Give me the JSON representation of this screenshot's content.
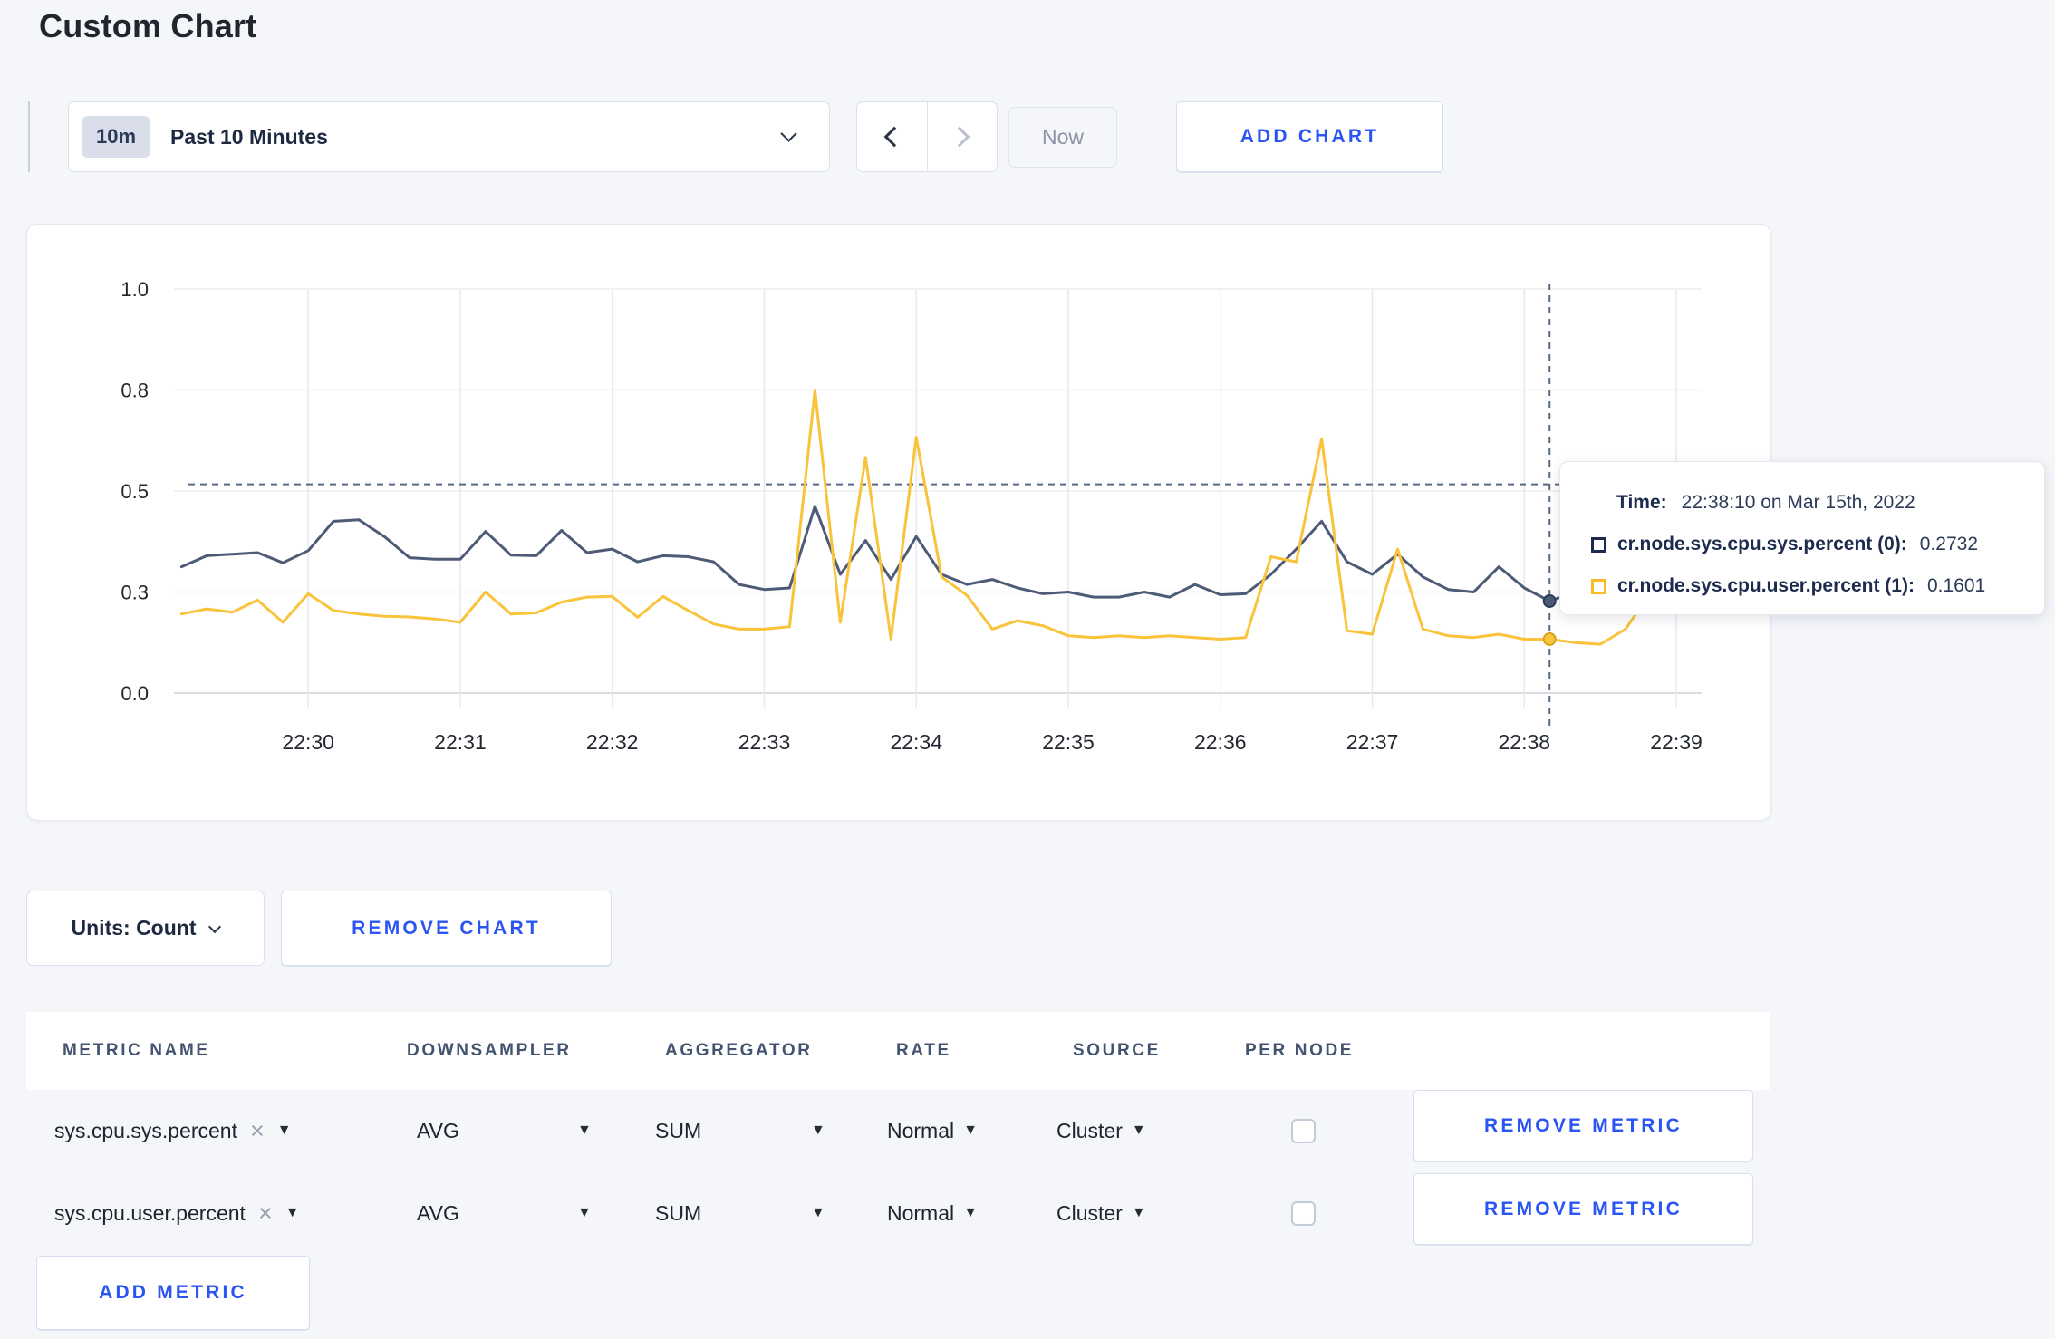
{
  "page": {
    "title": "Custom Chart"
  },
  "toolbar": {
    "time_range_badge": "10m",
    "time_range_label": "Past 10 Minutes",
    "prev_label": "previous time window",
    "next_label": "next time window",
    "now_label": "Now",
    "add_chart_label": "ADD CHART"
  },
  "chart_data": {
    "type": "line",
    "title": "Custom Chart",
    "ylabel": "",
    "xlabel": "",
    "ylim": [
      0,
      1
    ],
    "grid": true,
    "y_ticks": [
      0,
      0.3,
      0.5,
      0.8,
      1.0
    ],
    "y_tick_labels": [
      "0.0",
      "0.3",
      "0.5",
      "0.8",
      "1.0"
    ],
    "x_tick_labels": [
      "22:30",
      "22:31",
      "22:32",
      "22:33",
      "22:34",
      "22:35",
      "22:36",
      "22:37",
      "22:38",
      "22:39"
    ],
    "window_start": "22:29:07",
    "window_end": "22:39:10",
    "start_time": "22:29:10",
    "interval_seconds": 10,
    "crosshair": {
      "time": "22:38:10",
      "mouse_y_value": 0.52,
      "color": "#5a6a84"
    },
    "series": [
      {
        "name": "cr.node.sys.cpu.sys.percent",
        "color": "#4d5b77",
        "dot_stroke": "#2d3a55",
        "values": [
          0.35,
          0.372,
          0.375,
          0.378,
          0.358,
          0.382,
          0.44,
          0.443,
          0.41,
          0.368,
          0.365,
          0.365,
          0.42,
          0.373,
          0.372,
          0.422,
          0.378,
          0.385,
          0.36,
          0.372,
          0.37,
          0.36,
          0.315,
          0.305,
          0.308,
          0.47,
          0.335,
          0.402,
          0.325,
          0.41,
          0.335,
          0.315,
          0.325,
          0.308,
          0.295,
          0.3,
          0.285,
          0.285,
          0.3,
          0.285,
          0.315,
          0.292,
          0.295,
          0.335,
          0.385,
          0.44,
          0.36,
          0.335,
          0.375,
          0.33,
          0.305,
          0.3,
          0.35,
          0.308,
          0.2732,
          0.3,
          0.295,
          0.315,
          0.302,
          0.31,
          0.3
        ]
      },
      {
        "name": "cr.node.sys.cpu.user.percent",
        "color": "#f9c33c",
        "dot_stroke": "#d9a21c",
        "values": [
          0.235,
          0.25,
          0.24,
          0.276,
          0.21,
          0.295,
          0.245,
          0.235,
          0.228,
          0.226,
          0.22,
          0.21,
          0.3,
          0.235,
          0.238,
          0.27,
          0.285,
          0.287,
          0.225,
          0.287,
          0.245,
          0.205,
          0.19,
          0.19,
          0.197,
          0.8,
          0.21,
          0.6,
          0.16,
          0.66,
          0.33,
          0.29,
          0.19,
          0.215,
          0.2,
          0.17,
          0.165,
          0.17,
          0.165,
          0.17,
          0.165,
          0.16,
          0.165,
          0.37,
          0.36,
          0.655,
          0.185,
          0.175,
          0.385,
          0.19,
          0.17,
          0.165,
          0.175,
          0.16,
          0.1601,
          0.15,
          0.145,
          0.19,
          0.3,
          0.25,
          0.285
        ]
      }
    ]
  },
  "tooltip": {
    "time_label": "Time:",
    "time_value": "22:38:10 on Mar 15th, 2022",
    "series": [
      {
        "name": "cr.node.sys.cpu.sys.percent (0):",
        "value": "0.2732",
        "color": "#1b2a4e"
      },
      {
        "name": "cr.node.sys.cpu.user.percent (1):",
        "value": "0.1601",
        "color": "#fdbb26"
      }
    ]
  },
  "chart_footer": {
    "units_label": "Units: Count",
    "remove_chart_label": "REMOVE CHART"
  },
  "metrics_table": {
    "headers": [
      "METRIC NAME",
      "DOWNSAMPLER",
      "AGGREGATOR",
      "RATE",
      "SOURCE",
      "PER NODE"
    ],
    "rows": [
      {
        "metric_name": "sys.cpu.sys.percent",
        "downsampler": "AVG",
        "aggregator": "SUM",
        "rate": "Normal",
        "source": "Cluster",
        "per_node_checked": false,
        "remove_label": "REMOVE METRIC"
      },
      {
        "metric_name": "sys.cpu.user.percent",
        "downsampler": "AVG",
        "aggregator": "SUM",
        "rate": "Normal",
        "source": "Cluster",
        "per_node_checked": false,
        "remove_label": "REMOVE METRIC"
      }
    ],
    "add_metric_label": "ADD METRIC"
  },
  "colors": {
    "accent_blue": "#2a54f4",
    "page_background": "#f4f6fa",
    "grid_line": "#ebedf1"
  }
}
